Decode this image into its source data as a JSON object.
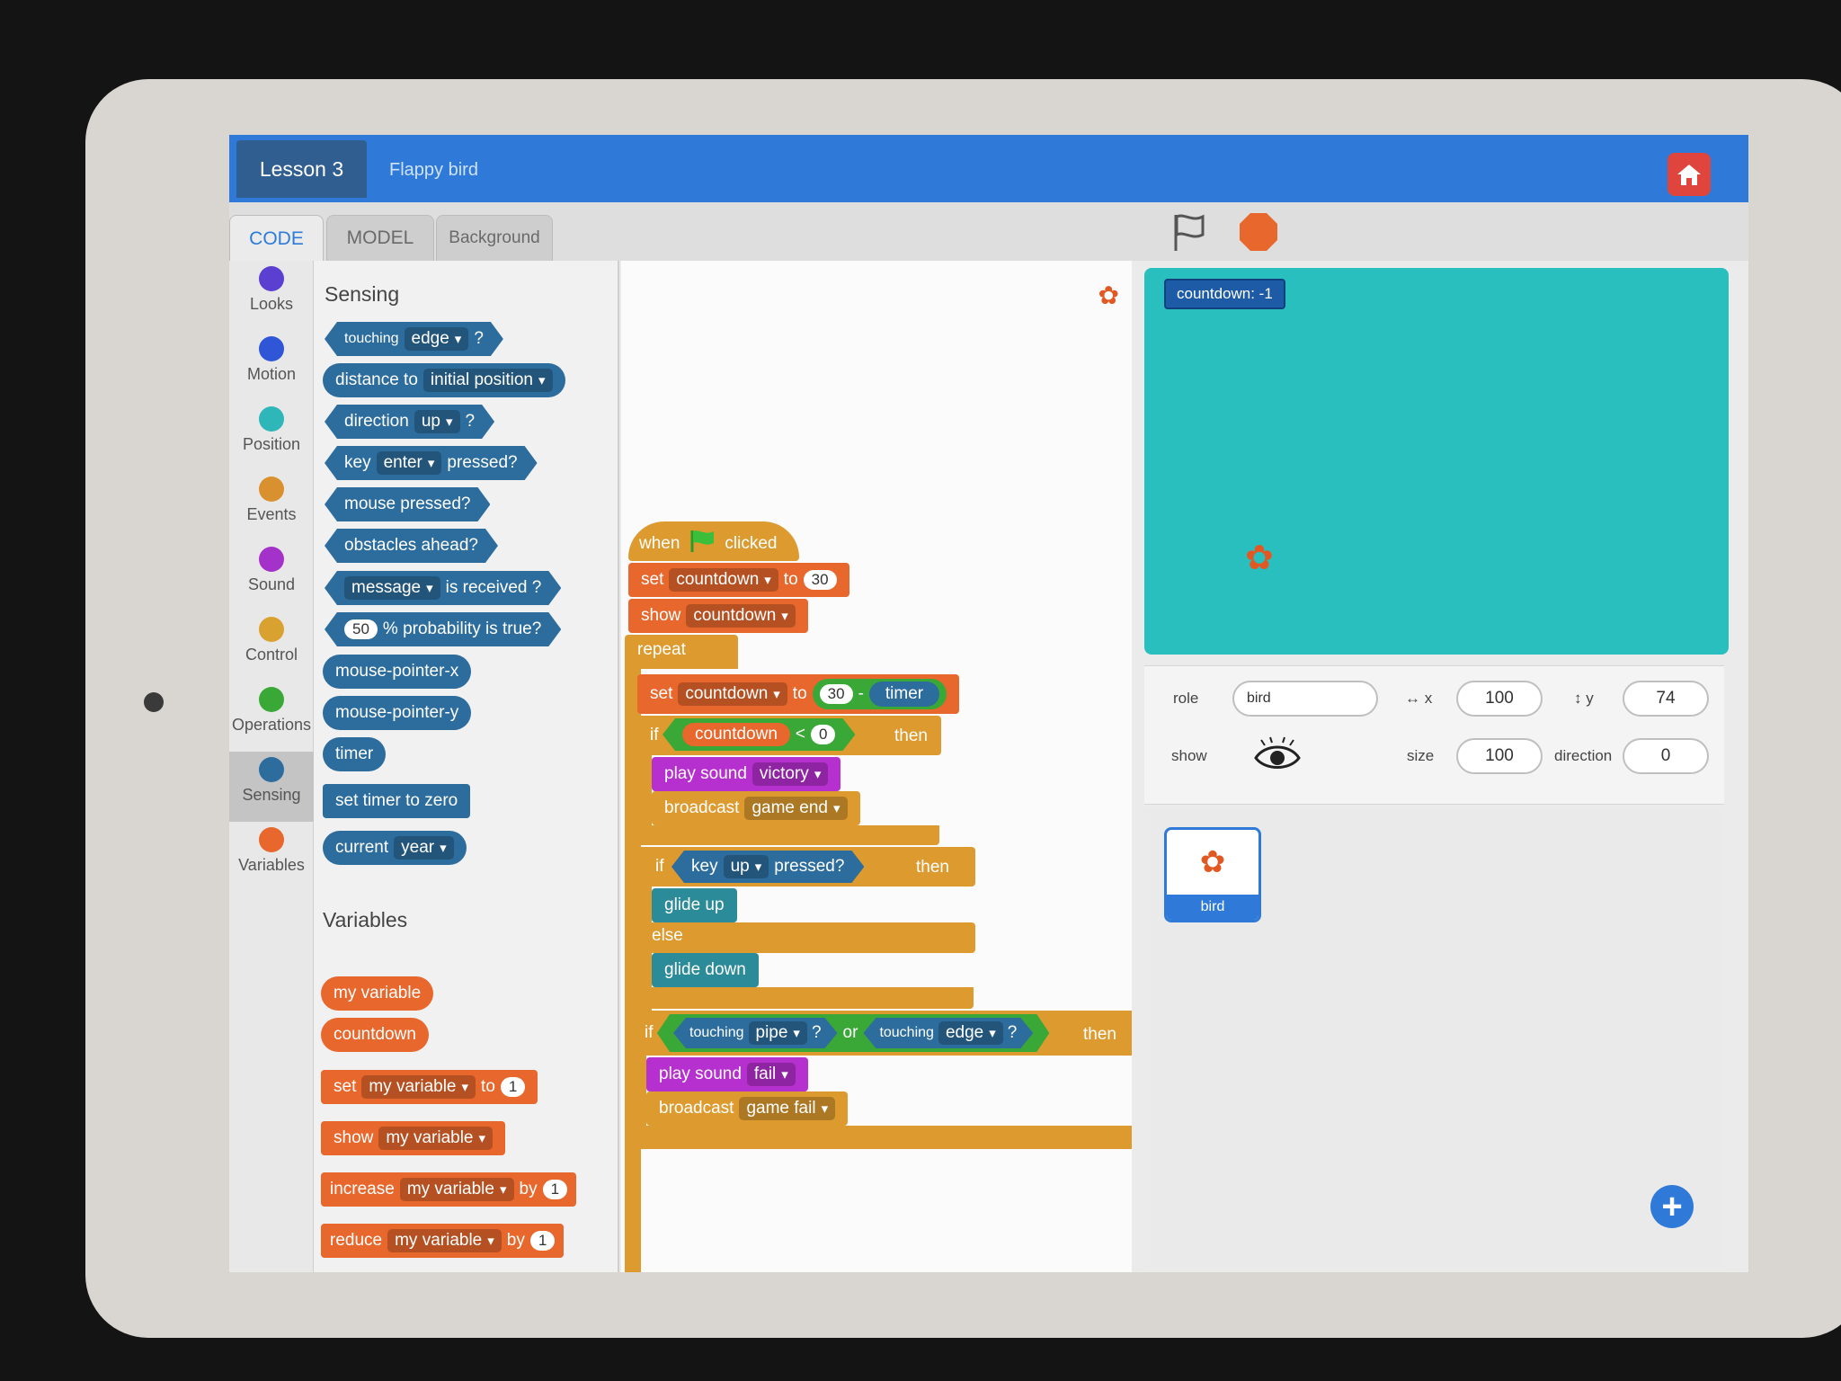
{
  "header": {
    "lesson": "Lesson 3",
    "project": "Flappy bird"
  },
  "tabs": [
    {
      "label": "CODE"
    },
    {
      "label": "MODEL"
    },
    {
      "label": "Background"
    }
  ],
  "categories": [
    {
      "label": "Looks",
      "color": "#5b3fd1"
    },
    {
      "label": "Motion",
      "color": "#2f56d6"
    },
    {
      "label": "Position",
      "color": "#2fb6b8"
    },
    {
      "label": "Events",
      "color": "#d9912f"
    },
    {
      "label": "Sound",
      "color": "#a431c9"
    },
    {
      "label": "Control",
      "color": "#d9a12f"
    },
    {
      "label": "Operations",
      "color": "#3aa836"
    },
    {
      "label": "Sensing",
      "color": "#2d6d9e"
    },
    {
      "label": "Variables",
      "color": "#e8672c"
    }
  ],
  "palette": {
    "sensing_title": "Sensing",
    "variables_title": "Variables",
    "touching": {
      "text": "touching",
      "option": "edge",
      "end": "?"
    },
    "distance": {
      "text": "distance to",
      "option": "initial position"
    },
    "direction": {
      "text": "direction",
      "option": "up",
      "end": "?"
    },
    "key": {
      "text": "key",
      "option": "enter",
      "end": "pressed?"
    },
    "mouse_pressed": "mouse pressed?",
    "obstacles": "obstacles ahead?",
    "message": {
      "option": "message",
      "end": "is received ?"
    },
    "probability": {
      "num": "50",
      "text": "% probability is true?"
    },
    "mouse_x": "mouse-pointer-x",
    "mouse_y": "mouse-pointer-y",
    "timer": "timer",
    "set_timer": "set timer to zero",
    "current": {
      "text": "current",
      "option": "year"
    },
    "vars": [
      "my variable",
      "countdown"
    ],
    "set_var": {
      "text": "set",
      "option": "my variable",
      "to": "to",
      "num": "1"
    },
    "show_var": {
      "text": "show",
      "option": "my variable"
    },
    "increase_var": {
      "text": "increase",
      "option": "my variable",
      "by": "by",
      "num": "1"
    },
    "reduce_var": {
      "text": "reduce",
      "option": "my variable",
      "by": "by",
      "num": "1"
    }
  },
  "script": {
    "hat": {
      "when": "when",
      "clicked": "clicked"
    },
    "set1": {
      "text": "set",
      "option": "countdown",
      "to": "to",
      "num": "30"
    },
    "show1": {
      "text": "show",
      "option": "countdown"
    },
    "repeat": "repeat",
    "set2": {
      "text": "set",
      "option": "countdown",
      "to": "to",
      "num": "30",
      "minus": "-",
      "timer": "timer"
    },
    "if1": {
      "if": "if",
      "var": "countdown",
      "op": "<",
      "num": "0",
      "then": "then"
    },
    "play1": {
      "text": "play sound",
      "option": "victory"
    },
    "broadcast1": {
      "text": "broadcast",
      "option": "game end"
    },
    "if2": {
      "if": "if",
      "key": "key",
      "option": "up",
      "pressed": "pressed?",
      "then": "then"
    },
    "glide_up": "glide up",
    "else": "else",
    "glide_down": "glide down",
    "if3": {
      "if": "if",
      "touching": "touching",
      "opt1": "pipe",
      "q": "?",
      "or": "or",
      "touching2": "touching",
      "opt2": "edge",
      "q2": "?",
      "then": "then"
    },
    "play2": {
      "text": "play sound",
      "option": "fail"
    },
    "broadcast2": {
      "text": "broadcast",
      "option": "game fail"
    }
  },
  "stage": {
    "monitor": "countdown:  -1"
  },
  "sprite_props": {
    "role_label": "role",
    "role_value": "bird",
    "x_label": "↔ x",
    "x_value": "100",
    "y_label": "↕ y",
    "y_value": "74",
    "show_label": "show",
    "size_label": "size",
    "size_value": "100",
    "direction_label": "direction",
    "direction_value": "0"
  },
  "sprites": [
    {
      "name": "bird"
    }
  ]
}
